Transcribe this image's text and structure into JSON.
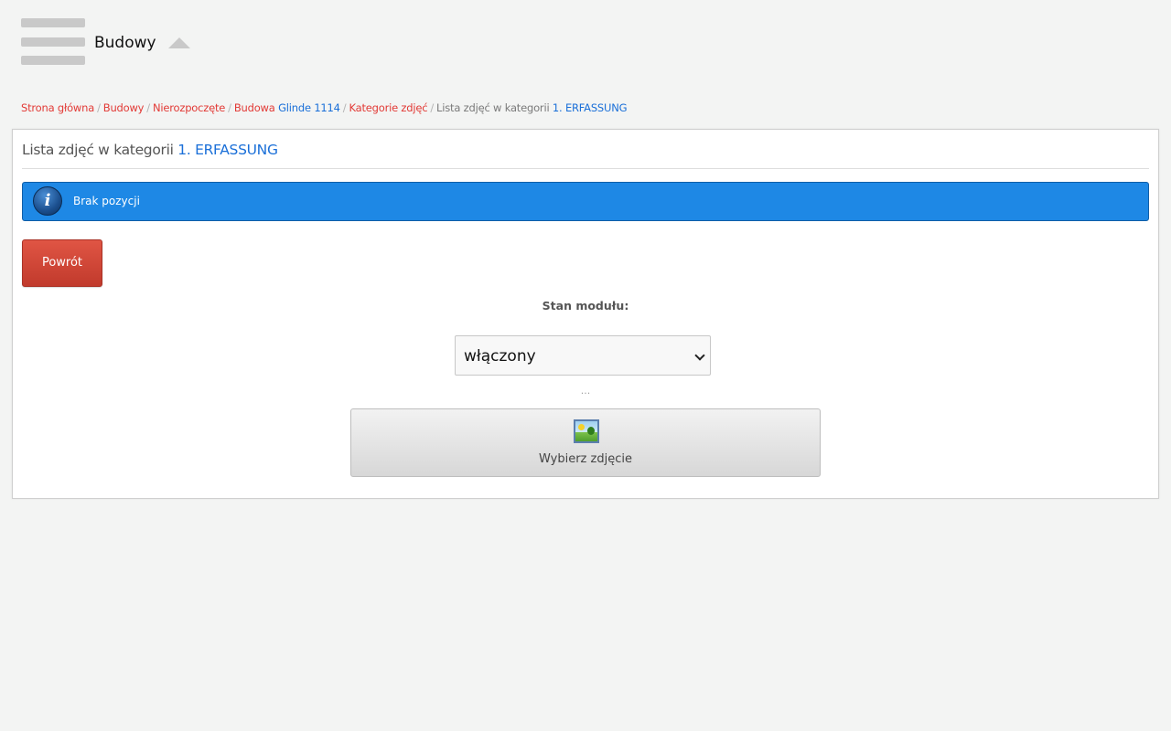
{
  "header": {
    "app_title": "Budowy",
    "menu_icon": "hamburger-menu-icon",
    "collapse_icon": "caret-up-icon"
  },
  "breadcrumb": {
    "items": [
      {
        "label": "Strona główna"
      },
      {
        "label": "Budowy"
      },
      {
        "label": "Nierozpoczęte"
      },
      {
        "label": "Budowa",
        "highlight": "Glinde 1114"
      },
      {
        "label": "Kategorie zdjęć"
      }
    ],
    "current": {
      "label": "Lista zdjęć w kategorii",
      "highlight": "1. ERFASSUNG"
    },
    "separator": "/"
  },
  "panel": {
    "title": "Lista zdjęć w kategorii",
    "title_highlight": "1. ERFASSUNG",
    "alert": {
      "text": "Brak pozycji",
      "icon": "info-icon",
      "color": "#1e88e5"
    },
    "back_button": {
      "label": "Powrót",
      "color": "#d9473a"
    },
    "module_state": {
      "label": "Stan modułu:",
      "selected": "włączony"
    },
    "dots": "...",
    "choose_photo_button": {
      "label": "Wybierz zdjęcie",
      "icon": "image-icon"
    }
  },
  "colors": {
    "link_red": "#e23a36",
    "link_blue": "#1a6fd8",
    "background": "#f3f4f3"
  }
}
